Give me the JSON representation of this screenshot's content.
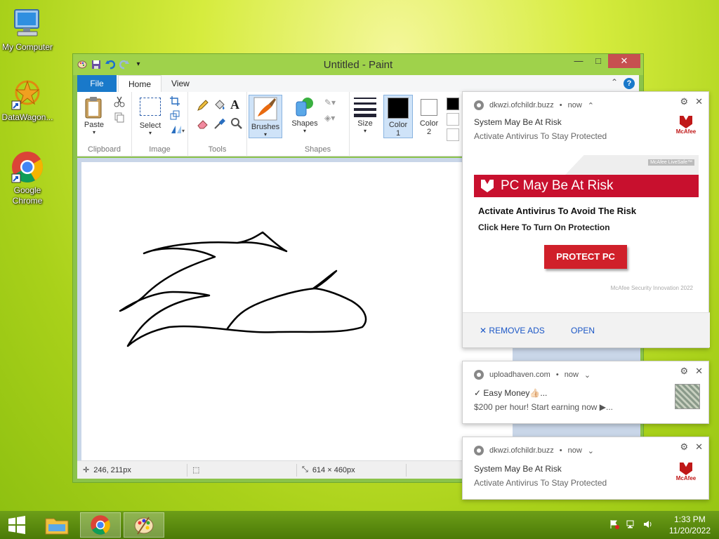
{
  "desktop": {
    "icons": [
      {
        "label": "My Computer",
        "icon": "computer-icon"
      },
      {
        "label": "DataWagon...",
        "icon": "datawagon-icon"
      },
      {
        "label": "Google Chrome",
        "icon": "chrome-icon"
      }
    ]
  },
  "paint": {
    "title": "Untitled - Paint",
    "tabs": {
      "file": "File",
      "home": "Home",
      "view": "View"
    },
    "groups": {
      "clipboard": "Clipboard",
      "image": "Image",
      "tools": "Tools",
      "shapes": "Shapes"
    },
    "buttons": {
      "paste": "Paste",
      "select": "Select",
      "brushes": "Brushes",
      "shapes": "Shapes",
      "size": "Size",
      "color1": "Color\n1",
      "color2": "Color\n2"
    },
    "color1": "#000000",
    "color2": "#ffffff",
    "status": {
      "cursor": "246, 211px",
      "canvas_size": "614 × 460px"
    }
  },
  "notifications": [
    {
      "source": "dkwzi.ofchildr.buzz",
      "time": "now",
      "title": "System May Be At Risk",
      "body": "Activate Antivirus To Stay Protected",
      "logo": "McAfee",
      "ad": {
        "corner_brand": "McAfee LiveSafe™",
        "banner": "PC May Be At Risk",
        "line1": "Activate Antivirus To Avoid The Risk",
        "line2": "Click Here To Turn On Protection",
        "button": "PROTECT PC",
        "footer": "McAfee Security Innovation 2022"
      },
      "actions": {
        "remove": "REMOVE ADS",
        "open": "OPEN"
      }
    },
    {
      "source": "uploadhaven.com",
      "time": "now",
      "title": "✓ Easy Money👍🏻...",
      "body": "$200 per hour! Start earning now ▶..."
    },
    {
      "source": "dkwzi.ofchildr.buzz",
      "time": "now",
      "title": "System May Be At Risk",
      "body": "Activate Antivirus To Stay Protected",
      "logo": "McAfee"
    }
  ],
  "taskbar": {
    "time": "1:33 PM",
    "date": "11/20/2022"
  },
  "colors": {
    "accent": "#1979ca",
    "mcafee_red": "#c8102e",
    "taskbar": "#5a8a0e"
  }
}
